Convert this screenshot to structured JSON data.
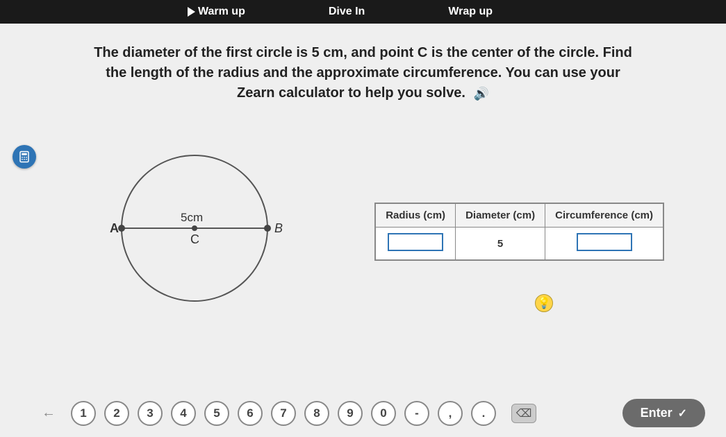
{
  "tabs": {
    "warmup": "Warm up",
    "divein": "Dive In",
    "wrapup": "Wrap up"
  },
  "prompt": {
    "line1": "The diameter of the first circle is 5 cm, and point C is the center of the circle. Find",
    "line2": "the length of the radius and the approximate circumference. You can use your",
    "line3": "Zearn calculator to help you solve."
  },
  "circle": {
    "pointA": "A",
    "pointB": "B",
    "center": "C",
    "diameter_label": "5cm"
  },
  "table": {
    "headers": {
      "radius": "Radius (cm)",
      "diameter": "Diameter (cm)",
      "circumference": "Circumference (cm)"
    },
    "row": {
      "radius": "",
      "diameter": "5",
      "circumference": ""
    }
  },
  "hint_symbol": "💡",
  "keypad": {
    "keys": [
      "1",
      "2",
      "3",
      "4",
      "5",
      "6",
      "7",
      "8",
      "9",
      "0",
      "-",
      ",",
      "."
    ],
    "backspace": "⌫",
    "enter": "Enter",
    "check": "✓"
  }
}
